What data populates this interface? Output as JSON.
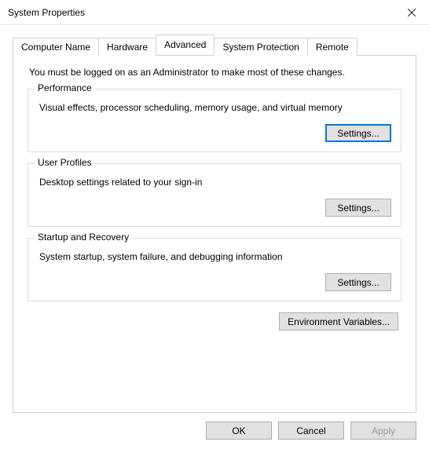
{
  "window": {
    "title": "System Properties"
  },
  "tabs": {
    "computer_name": "Computer Name",
    "hardware": "Hardware",
    "advanced": "Advanced",
    "system_protection": "System Protection",
    "remote": "Remote"
  },
  "intro": "You must be logged on as an Administrator to make most of these changes.",
  "performance": {
    "legend": "Performance",
    "desc": "Visual effects, processor scheduling, memory usage, and virtual memory",
    "button": "Settings..."
  },
  "user_profiles": {
    "legend": "User Profiles",
    "desc": "Desktop settings related to your sign-in",
    "button": "Settings..."
  },
  "startup_recovery": {
    "legend": "Startup and Recovery",
    "desc": "System startup, system failure, and debugging information",
    "button": "Settings..."
  },
  "env_button": "Environment Variables...",
  "footer": {
    "ok": "OK",
    "cancel": "Cancel",
    "apply": "Apply"
  }
}
